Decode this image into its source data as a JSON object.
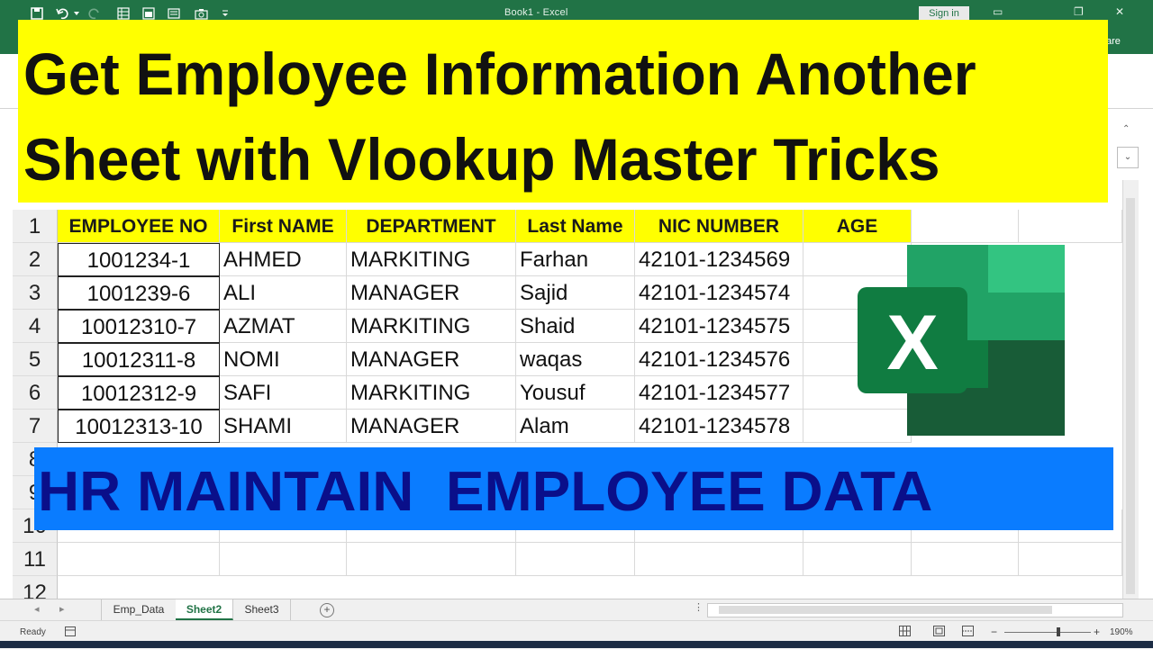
{
  "window": {
    "title": "Book1 - Excel",
    "signin_label": "Sign in",
    "share_label": "are"
  },
  "banner": {
    "line1": "Get Employee Information Another",
    "line2": "Sheet with Vlookup Master Tricks"
  },
  "grid": {
    "row_numbers": [
      "1",
      "2",
      "3",
      "4",
      "5",
      "6",
      "7",
      "8",
      "9",
      "10",
      "11",
      "12"
    ],
    "headers": [
      "EMPLOYEE NO",
      "First NAME",
      "DEPARTMENT",
      "Last Name",
      "NIC NUMBER",
      "AGE"
    ],
    "rows": [
      [
        "1001234-1",
        "AHMED",
        "MARKITING",
        "Farhan",
        "42101-1234569"
      ],
      [
        "1001239-6",
        "ALI",
        "MANAGER",
        "Sajid",
        "42101-1234574"
      ],
      [
        "10012310-7",
        "AZMAT",
        "MARKITING",
        "Shaid",
        "42101-1234575"
      ],
      [
        "10012311-8",
        "NOMI",
        "MANAGER",
        "waqas",
        "42101-1234576"
      ],
      [
        "10012312-9",
        "SAFI",
        "MARKITING",
        "Yousuf",
        "42101-1234577"
      ],
      [
        "10012313-10",
        "SHAMI",
        "MANAGER",
        "Alam",
        "42101-1234578"
      ]
    ]
  },
  "logo": {
    "letter": "X",
    "colors": {
      "dark": "#185c37",
      "mid": "#21a366",
      "light": "#33c481",
      "tile": "#107c41"
    }
  },
  "blue_banner": {
    "text": "HR MAINTAIN  EMPLOYEE DATA"
  },
  "sheet_tabs": [
    {
      "label": "Emp_Data",
      "active": false
    },
    {
      "label": "Sheet2",
      "active": true
    },
    {
      "label": "Sheet3",
      "active": false
    }
  ],
  "status": {
    "ready": "Ready",
    "zoom": "190%"
  },
  "colors": {
    "excel_green": "#217346",
    "banner_yellow": "#ffff00",
    "banner_blue": "#0a7cff",
    "banner_text_blue": "#0a0f8a"
  }
}
